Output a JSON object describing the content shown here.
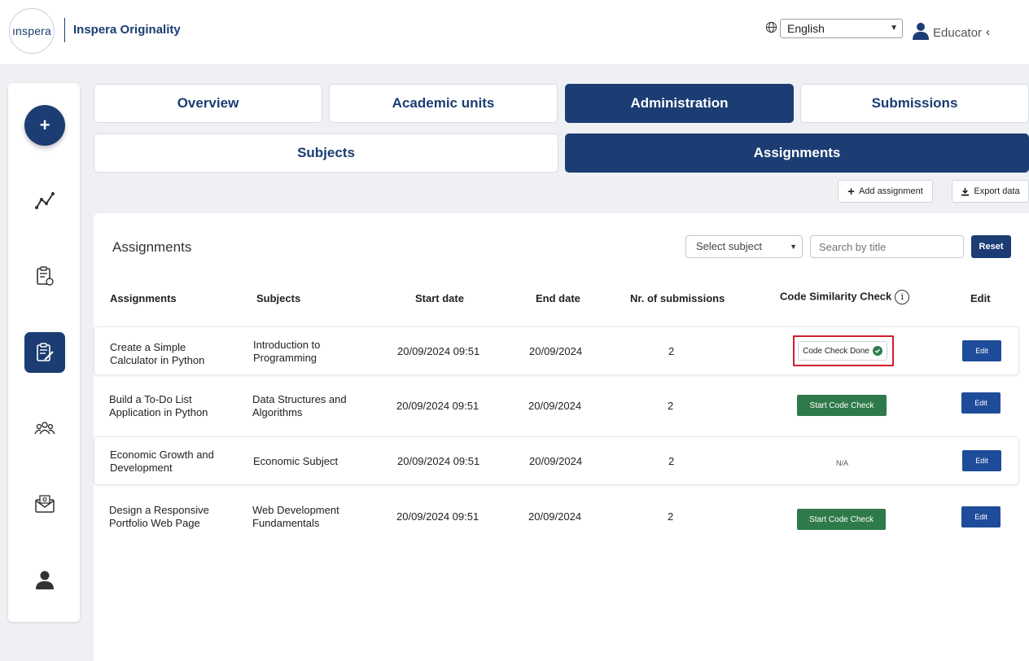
{
  "header": {
    "logo_text": "ınspera",
    "product_name": "Inspera Originality",
    "language": "English",
    "user_label": "Educator"
  },
  "sidebar": {
    "fab_label": "+",
    "items": [
      {
        "icon": "analytics-icon"
      },
      {
        "icon": "document-certificate-icon"
      },
      {
        "icon": "assignments-edit-icon",
        "active": true
      },
      {
        "icon": "users-group-icon"
      },
      {
        "icon": "mail-icon"
      },
      {
        "icon": "profile-icon"
      }
    ]
  },
  "tabs": {
    "primary": [
      {
        "label": "Overview"
      },
      {
        "label": "Academic units"
      },
      {
        "label": "Administration",
        "active": true
      },
      {
        "label": "Submissions"
      }
    ],
    "secondary": [
      {
        "label": "Subjects"
      },
      {
        "label": "Assignments",
        "active": true
      }
    ]
  },
  "actions": {
    "add_assignment": "Add assignment",
    "export_data": "Export data"
  },
  "panel": {
    "title": "Assignments",
    "subject_select": "Select subject",
    "search_placeholder": "Search by title",
    "reset": "Reset"
  },
  "table": {
    "columns": [
      "Assignments",
      "Subjects",
      "Start date",
      "End date",
      "Nr. of submissions",
      "Code Similarity Check",
      "Edit"
    ],
    "rows": [
      {
        "assignment": "Create a Simple Calculator in Python",
        "subject": "Introduction to Programming",
        "start": "20/09/2024 09:51",
        "end": "20/09/2024",
        "submissions": "2",
        "check": "Code Check Done",
        "check_state": "done",
        "edit": "Edit"
      },
      {
        "assignment": "Build a To-Do List Application in Python",
        "subject": "Data Structures and Algorithms",
        "start": "20/09/2024 09:51",
        "end": "20/09/2024",
        "submissions": "2",
        "check": "Start Code Check",
        "check_state": "start",
        "edit": "Edit"
      },
      {
        "assignment": "Economic Growth and Development",
        "subject": "Economic Subject",
        "start": "20/09/2024 09:51",
        "end": "20/09/2024",
        "submissions": "2",
        "check": "N/A",
        "check_state": "na",
        "edit": "Edit"
      },
      {
        "assignment": "Design a Responsive Portfolio Web Page",
        "subject": "Web Development Fundamentals",
        "start": "20/09/2024 09:51",
        "end": "20/09/2024",
        "submissions": "2",
        "check": "Start Code Check",
        "check_state": "start",
        "edit": "Edit"
      }
    ]
  },
  "colors": {
    "brand": "#1b3d73",
    "success": "#2f7a4a",
    "edit": "#1f4c9a",
    "highlight": "#d01f2a"
  }
}
